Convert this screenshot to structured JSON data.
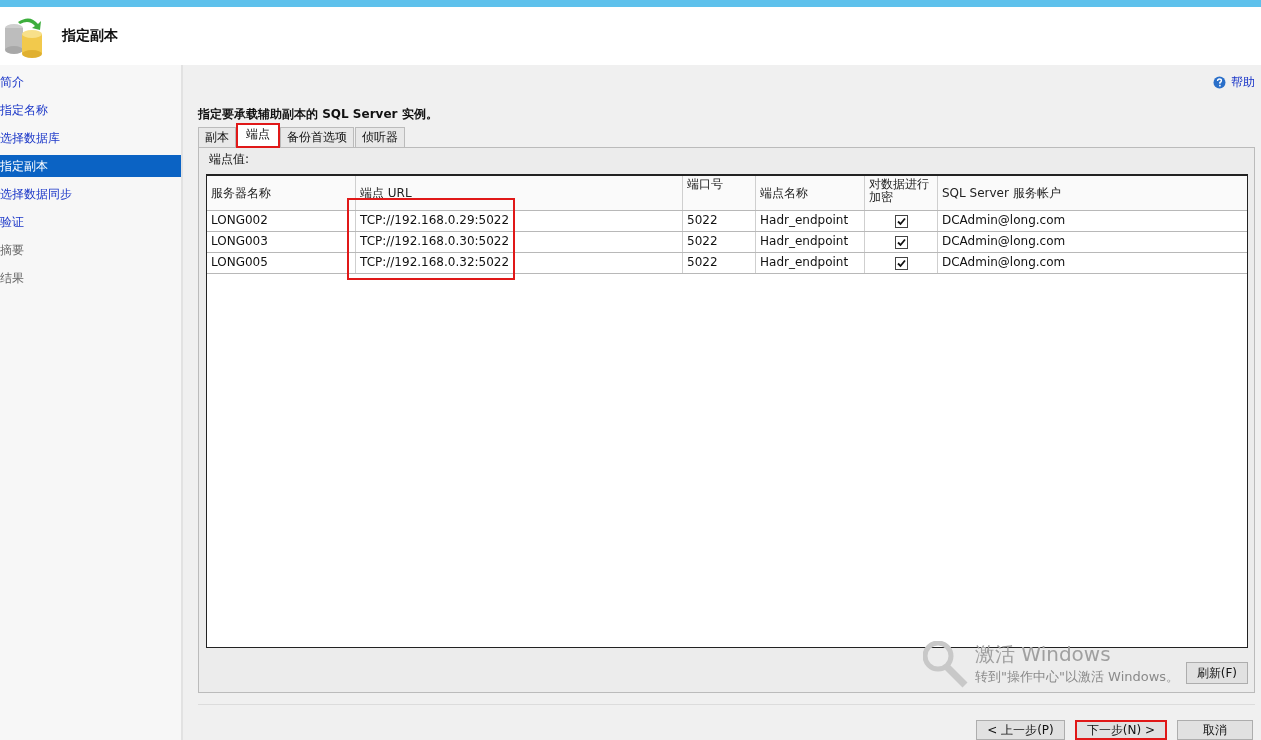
{
  "header": {
    "title": "指定副本"
  },
  "sidebar": {
    "items": [
      {
        "label": "简介",
        "selected": false,
        "disabled": false
      },
      {
        "label": "指定名称",
        "selected": false,
        "disabled": false
      },
      {
        "label": "选择数据库",
        "selected": false,
        "disabled": false
      },
      {
        "label": "指定副本",
        "selected": true,
        "disabled": false
      },
      {
        "label": "选择数据同步",
        "selected": false,
        "disabled": false
      },
      {
        "label": "验证",
        "selected": false,
        "disabled": false
      },
      {
        "label": "摘要",
        "selected": false,
        "disabled": true
      },
      {
        "label": "结果",
        "selected": false,
        "disabled": true
      }
    ]
  },
  "help": "帮助",
  "heading": "指定要承载辅助副本的 **SQL Server** 实例。",
  "tabs": [
    {
      "label": "副本",
      "selected": false,
      "annotated": false
    },
    {
      "label": "端点",
      "selected": true,
      "annotated": true
    },
    {
      "label": "备份首选项",
      "selected": false,
      "annotated": false
    },
    {
      "label": "侦听器",
      "selected": false,
      "annotated": false
    }
  ],
  "section_label": "端点值:",
  "table": {
    "columns": [
      "服务器名称",
      "端点 URL",
      "端口号",
      "端点名称",
      "对数据进行加密",
      "SQL Server 服务帐户"
    ],
    "url_column_annotated": true,
    "rows": [
      {
        "server": "LONG002",
        "url": "TCP://192.168.0.29:5022",
        "port": "5022",
        "endpoint": "Hadr_endpoint",
        "encrypted": true,
        "account": "DCAdmin@long.com"
      },
      {
        "server": "LONG003",
        "url": "TCP://192.168.0.30:5022",
        "port": "5022",
        "endpoint": "Hadr_endpoint",
        "encrypted": true,
        "account": "DCAdmin@long.com"
      },
      {
        "server": "LONG005",
        "url": "TCP://192.168.0.32:5022",
        "port": "5022",
        "endpoint": "Hadr_endpoint",
        "encrypted": true,
        "account": "DCAdmin@long.com"
      }
    ]
  },
  "refresh_button": "刷新(F)",
  "watermark": {
    "title": "激活 Windows",
    "subtitle": "转到\"操作中心\"以激活 Windows。"
  },
  "buttons": [
    {
      "label": "< 上一步(P)",
      "annotated": false
    },
    {
      "label": "下一步(N) >",
      "annotated": true
    },
    {
      "label": "取消",
      "annotated": false
    }
  ]
}
